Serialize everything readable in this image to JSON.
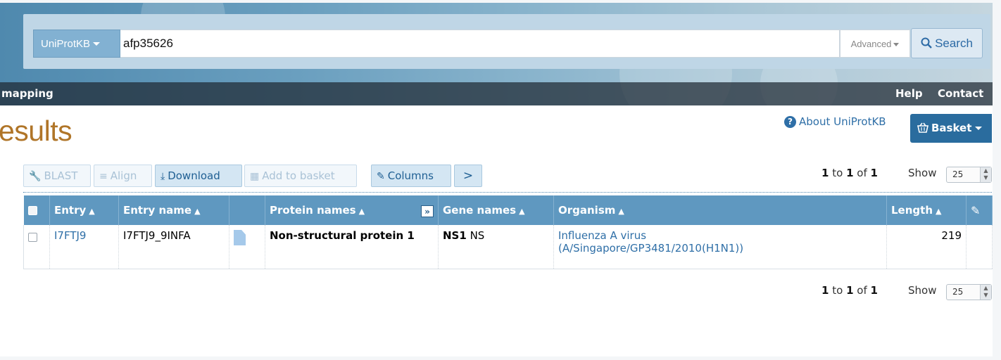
{
  "search": {
    "database": "UniProtKB",
    "query": "afp35626",
    "advanced_label": "Advanced",
    "search_label": "Search"
  },
  "nav": {
    "mapping": "mapping",
    "help": "Help",
    "contact": "Contact"
  },
  "page": {
    "title": "esults",
    "about": "About UniProtKB",
    "basket": "Basket"
  },
  "toolbar": {
    "blast": "BLAST",
    "align": "Align",
    "download": "Download",
    "add_to_basket": "Add to basket",
    "columns": "Columns"
  },
  "pagination": {
    "from": "1",
    "to_word": "to",
    "to": "1",
    "of_word": "of",
    "total": "1",
    "show_label": "Show",
    "page_size": "25"
  },
  "table": {
    "headers": {
      "entry": "Entry",
      "entry_name": "Entry name",
      "protein_names": "Protein names",
      "gene_names": "Gene names",
      "organism": "Organism",
      "length": "Length"
    },
    "rows": [
      {
        "entry": "I7FTJ9",
        "entry_name": "I7FTJ9_9INFA",
        "protein_name": "Non-structural protein 1",
        "gene_primary": "NS1",
        "gene_other": "NS",
        "organism_line1": "Influenza A virus",
        "organism_line2": "(A/Singapore/GP3481/2010(H1N1))",
        "length": "219"
      }
    ]
  },
  "colors": {
    "accent": "#2f6fa7",
    "header_bg": "#5f98c0",
    "title": "#b07528",
    "basket": "#2a6c9e"
  }
}
